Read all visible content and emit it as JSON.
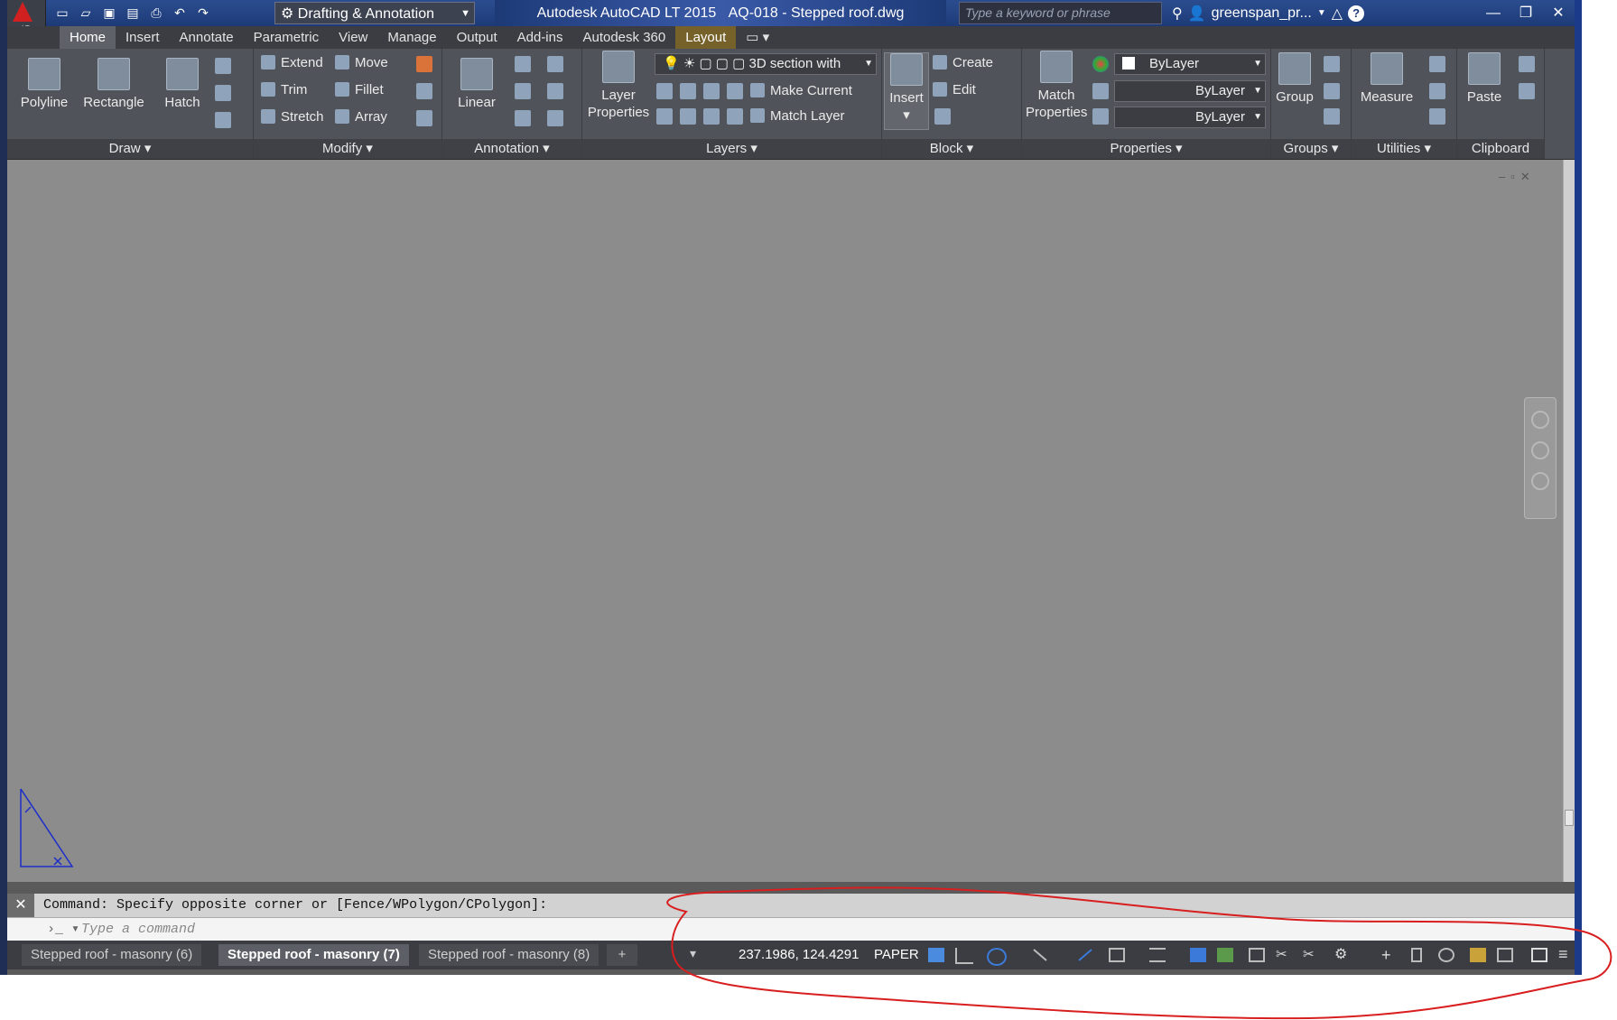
{
  "window": {
    "app_title": "Autodesk AutoCAD LT 2015",
    "file_title": "AQ-018 - Stepped roof.dwg",
    "workspace": "Drafting & Annotation",
    "search_placeholder": "Type a keyword or phrase",
    "user": "greenspan_pr...",
    "help": "?"
  },
  "tabs": [
    "Home",
    "Insert",
    "Annotate",
    "Parametric",
    "View",
    "Manage",
    "Output",
    "Add-ins",
    "Autodesk 360",
    "Layout"
  ],
  "active_tab": "Home",
  "ribbon": {
    "draw": {
      "label": "Draw",
      "polyline": "Polyline",
      "rectangle": "Rectangle",
      "hatch": "Hatch"
    },
    "modify": {
      "label": "Modify",
      "extend": "Extend",
      "move": "Move",
      "trim": "Trim",
      "fillet": "Fillet",
      "stretch": "Stretch",
      "array": "Array"
    },
    "annotation": {
      "label": "Annotation",
      "linear": "Linear"
    },
    "layers": {
      "label": "Layers",
      "layer_properties": "Layer Properties",
      "current_layer": "3D section with",
      "make_current": "Make Current",
      "match_layer": "Match Layer"
    },
    "block": {
      "label": "Block",
      "insert": "Insert",
      "create": "Create",
      "edit": "Edit"
    },
    "properties": {
      "label": "Properties",
      "match_properties": "Match Properties",
      "color": "ByLayer",
      "linetype": "ByLayer",
      "lineweight": "ByLayer"
    },
    "groups": {
      "label": "Groups",
      "group": "Group"
    },
    "utilities": {
      "label": "Utilities",
      "measure": "Measure"
    },
    "clipboard": {
      "label": "Clipboard",
      "paste": "Paste"
    }
  },
  "command": {
    "history": "Command: Specify opposite corner or [Fence/WPolygon/CPolygon]:",
    "placeholder": "Type a command"
  },
  "layout_tabs": [
    "Stepped roof - masonry (6)",
    "Stepped roof - masonry (7)",
    "Stepped roof - masonry (8)"
  ],
  "active_layout": "Stepped roof - masonry (7)",
  "status": {
    "coordinates": "237.1986, 124.4291",
    "space": "PAPER"
  },
  "colors": {
    "canvas": "#8c8c8c",
    "ribbon": "#505359",
    "titlebar": "#1d3a77",
    "annotation": "#d81e1e",
    "ucs": "#1c2ec9"
  }
}
